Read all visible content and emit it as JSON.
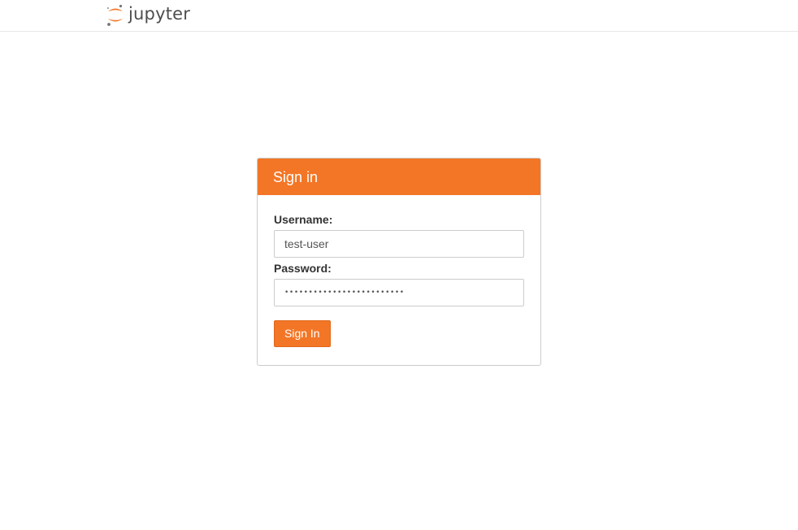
{
  "header": {
    "logo_text": "jupyter",
    "logo_icon": "jupyter-logo-icon",
    "brand_color": "#f37626"
  },
  "login": {
    "title": "Sign in",
    "username_label": "Username:",
    "username_value": "test-user",
    "password_label": "Password:",
    "password_value": "•••••••••••••••••••••••••",
    "submit_label": "Sign In"
  },
  "colors": {
    "accent": "#f37626",
    "border": "#cccccc",
    "text": "#333333"
  }
}
